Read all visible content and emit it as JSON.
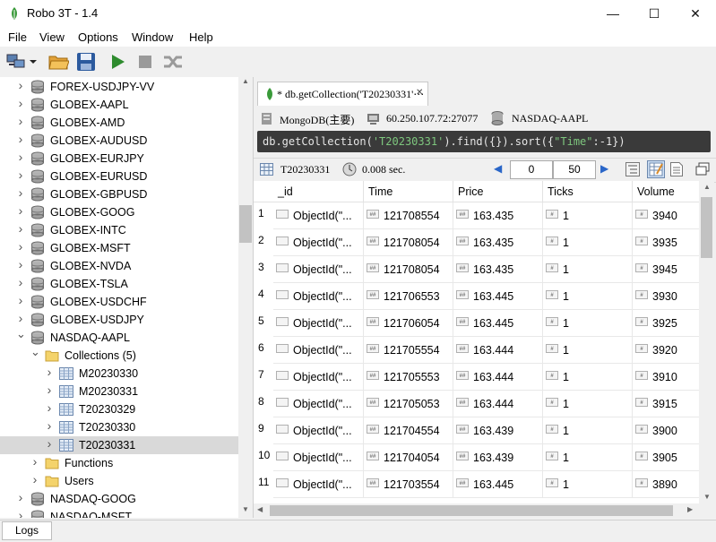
{
  "window": {
    "title": "Robo 3T - 1.4",
    "controls": [
      "—",
      "☐",
      "✕"
    ]
  },
  "menu": [
    "File",
    "View",
    "Options",
    "Window",
    "Help"
  ],
  "tree": {
    "items": [
      {
        "label": "FOREX-USDJPY-VV",
        "icon": "database-icon",
        "expanded": false
      },
      {
        "label": "GLOBEX-AAPL",
        "icon": "database-icon",
        "expanded": false
      },
      {
        "label": "GLOBEX-AMD",
        "icon": "database-icon",
        "expanded": false
      },
      {
        "label": "GLOBEX-AUDUSD",
        "icon": "database-icon",
        "expanded": false
      },
      {
        "label": "GLOBEX-EURJPY",
        "icon": "database-icon",
        "expanded": false
      },
      {
        "label": "GLOBEX-EURUSD",
        "icon": "database-icon",
        "expanded": false
      },
      {
        "label": "GLOBEX-GBPUSD",
        "icon": "database-icon",
        "expanded": false
      },
      {
        "label": "GLOBEX-GOOG",
        "icon": "database-icon",
        "expanded": false
      },
      {
        "label": "GLOBEX-INTC",
        "icon": "database-icon",
        "expanded": false
      },
      {
        "label": "GLOBEX-MSFT",
        "icon": "database-icon",
        "expanded": false
      },
      {
        "label": "GLOBEX-NVDA",
        "icon": "database-icon",
        "expanded": false
      },
      {
        "label": "GLOBEX-TSLA",
        "icon": "database-icon",
        "expanded": false
      },
      {
        "label": "GLOBEX-USDCHF",
        "icon": "database-icon",
        "expanded": false
      },
      {
        "label": "GLOBEX-USDJPY",
        "icon": "database-icon",
        "expanded": false
      },
      {
        "label": "NASDAQ-AAPL",
        "icon": "database-icon",
        "expanded": true
      },
      {
        "label": "Collections (5)",
        "icon": "folder-icon",
        "expanded": true
      },
      {
        "label": "M20230330",
        "icon": "collection-icon",
        "expanded": false
      },
      {
        "label": "M20230331",
        "icon": "collection-icon",
        "expanded": false
      },
      {
        "label": "T20230329",
        "icon": "collection-icon",
        "expanded": false
      },
      {
        "label": "T20230330",
        "icon": "collection-icon",
        "expanded": false
      },
      {
        "label": "T20230331",
        "icon": "collection-icon",
        "expanded": false,
        "selected": true
      },
      {
        "label": "Functions",
        "icon": "folder-icon",
        "expanded": false
      },
      {
        "label": "Users",
        "icon": "folder-icon",
        "expanded": false
      },
      {
        "label": "NASDAQ-GOOG",
        "icon": "database-icon",
        "expanded": false
      },
      {
        "label": "NASDAQ-MSFT",
        "icon": "database-icon",
        "expanded": false
      }
    ]
  },
  "tab": {
    "label": "* db.getCollection('T20230331'⋯",
    "close": "✕"
  },
  "info": {
    "server": "MongoDB(主要)",
    "address": "60.250.107.72:27077",
    "database": "NASDAQ-AAPL"
  },
  "query": {
    "prefix": "db.getCollection(",
    "arg": "'T20230331'",
    "mid": ").find({}).sort({",
    "key": "\"Time\"",
    "tail": ":-1})"
  },
  "results": {
    "collection": "T20230331",
    "time": "0.008 sec.",
    "skip": "0",
    "limit": "50"
  },
  "grid": {
    "columns": [
      "_id",
      "Time",
      "Price",
      "Ticks",
      "Volume"
    ],
    "rows": [
      {
        "n": "1",
        "id": "ObjectId(\"...",
        "time": "121708554",
        "price": "163.435",
        "ticks": "1",
        "volume": "3940"
      },
      {
        "n": "2",
        "id": "ObjectId(\"...",
        "time": "121708054",
        "price": "163.435",
        "ticks": "1",
        "volume": "3935"
      },
      {
        "n": "3",
        "id": "ObjectId(\"...",
        "time": "121708054",
        "price": "163.435",
        "ticks": "1",
        "volume": "3945"
      },
      {
        "n": "4",
        "id": "ObjectId(\"...",
        "time": "121706553",
        "price": "163.445",
        "ticks": "1",
        "volume": "3930"
      },
      {
        "n": "5",
        "id": "ObjectId(\"...",
        "time": "121706054",
        "price": "163.445",
        "ticks": "1",
        "volume": "3925"
      },
      {
        "n": "6",
        "id": "ObjectId(\"...",
        "time": "121705554",
        "price": "163.444",
        "ticks": "1",
        "volume": "3920"
      },
      {
        "n": "7",
        "id": "ObjectId(\"...",
        "time": "121705553",
        "price": "163.444",
        "ticks": "1",
        "volume": "3910"
      },
      {
        "n": "8",
        "id": "ObjectId(\"...",
        "time": "121705053",
        "price": "163.444",
        "ticks": "1",
        "volume": "3915"
      },
      {
        "n": "9",
        "id": "ObjectId(\"...",
        "time": "121704554",
        "price": "163.439",
        "ticks": "1",
        "volume": "3900"
      },
      {
        "n": "10",
        "id": "ObjectId(\"...",
        "time": "121704054",
        "price": "163.439",
        "ticks": "1",
        "volume": "3905"
      },
      {
        "n": "11",
        "id": "ObjectId(\"...",
        "time": "121703554",
        "price": "163.445",
        "ticks": "1",
        "volume": "3890"
      }
    ]
  },
  "logs": {
    "label": "Logs"
  },
  "colors": {
    "accent": "#2e8b2e",
    "selection": "#d9d9d9",
    "query_bg": "#3a3a3a",
    "query_string": "#7ec77e"
  }
}
